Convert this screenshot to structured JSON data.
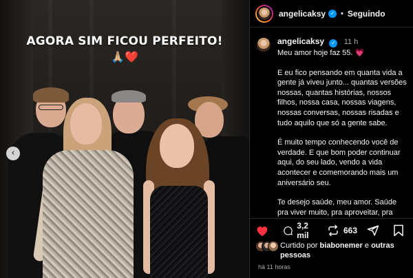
{
  "photo": {
    "overlay_text": "AGORA SIM FICOU PERFEITO!",
    "overlay_emoji_pray": "🙏🏼",
    "overlay_emoji_heart": "❤️",
    "prev_icon": "‹"
  },
  "header": {
    "username": "angelicaksy",
    "verified_mark": "✓",
    "separator": "•",
    "follow_label": "Seguindo"
  },
  "caption": {
    "username": "angelicaksy",
    "verified_mark": "✓",
    "time": "11 h",
    "first_line": "Meu amor hoje faz 55.",
    "first_line_heart": "💗",
    "paragraphs": [
      "E eu fico pensando em quanta vida a gente já viveu junto... quantas versões nossas, quantas histórias, nossos filhos, nossa casa, nossas viagens, nossas conversas, nossas risadas e tudo aquilo que só a gente sabe.",
      "É muito tempo conhecendo você de verdade. E que bom poder continuar aqui, do seu lado, vendo a vida acontecer e comemorando mais um aniversário seu.",
      "Te desejo saúde, meu amor. Saúde pra viver muito, pra aproveitar, pra inventar coisa nova, pra estar com quem você"
    ]
  },
  "actions": {
    "comments_count": "3,2 mil",
    "reposts_count": "663",
    "icons": [
      "heart-icon",
      "comment-icon",
      "repost-icon",
      "share-icon",
      "bookmark-icon"
    ],
    "like_color": "#ff3040"
  },
  "likes": {
    "prefix": "Curtido por ",
    "user": "biabonemer",
    "connector": " e ",
    "others": "outras pessoas"
  },
  "timestamp": "há 11 horas"
}
